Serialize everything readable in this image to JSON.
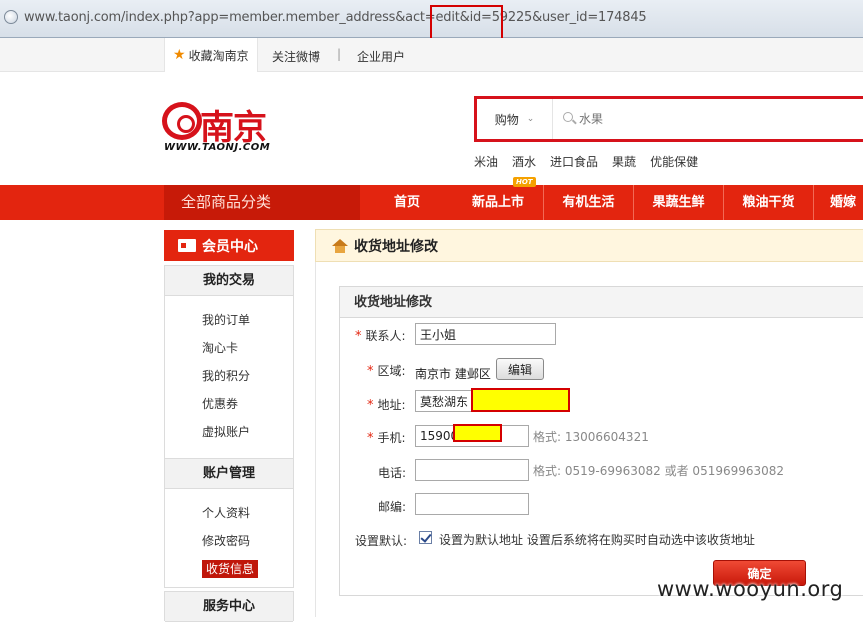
{
  "browser": {
    "url": "www.taonj.com/index.php?app=member.member_address&act=edit&id=59225&user_id=174845"
  },
  "topbar": {
    "favorite": "收藏淘南京",
    "weibo": "关注微博",
    "separator": "|",
    "business": "企业用户"
  },
  "logo": {
    "name": "南京",
    "site": "WWW.TAONJ.COM"
  },
  "search": {
    "category": "购物",
    "placeholder": "水果"
  },
  "hot_words": [
    "米油",
    "酒水",
    "进口食品",
    "果蔬",
    "优能保健"
  ],
  "nav": {
    "all_categories": "全部商品分类",
    "items": [
      "首页",
      "新品上市",
      "有机生活",
      "果蔬生鲜",
      "粮油干货",
      "婚嫁"
    ],
    "hot_badge": "HOT"
  },
  "sidebar": {
    "header": "会员中心",
    "sections": [
      {
        "title": "我的交易",
        "links": [
          "我的订单",
          "淘心卡",
          "我的积分",
          "优惠券",
          "虚拟账户"
        ]
      },
      {
        "title": "账户管理",
        "links": [
          "个人资料",
          "修改密码",
          "收货信息"
        ]
      },
      {
        "title": "服务中心",
        "links": []
      }
    ]
  },
  "page": {
    "crumb_title": "收货地址修改",
    "panel_title": "收货地址修改"
  },
  "form": {
    "required_mark": "*",
    "contact_label": "联系人:",
    "contact_value": "王小姐",
    "region_label": "区域:",
    "region_value": "南京市 建邺区",
    "edit_button": "编辑",
    "address_label": "地址:",
    "address_value": "莫愁湖东",
    "mobile_label": "手机:",
    "mobile_value": "15900",
    "mobile_hint": "格式: 13006604321",
    "phone_label": "电话:",
    "phone_value": "",
    "phone_hint": "格式: 0519-69963082 或者 051969963082",
    "zip_label": "邮编:",
    "zip_value": "",
    "default_label": "设置默认:",
    "default_text": "设置为默认地址 设置后系统将在购买时自动选中该收货地址",
    "default_checked": true,
    "submit": "确定"
  },
  "watermark": "www.wooyun.org"
}
